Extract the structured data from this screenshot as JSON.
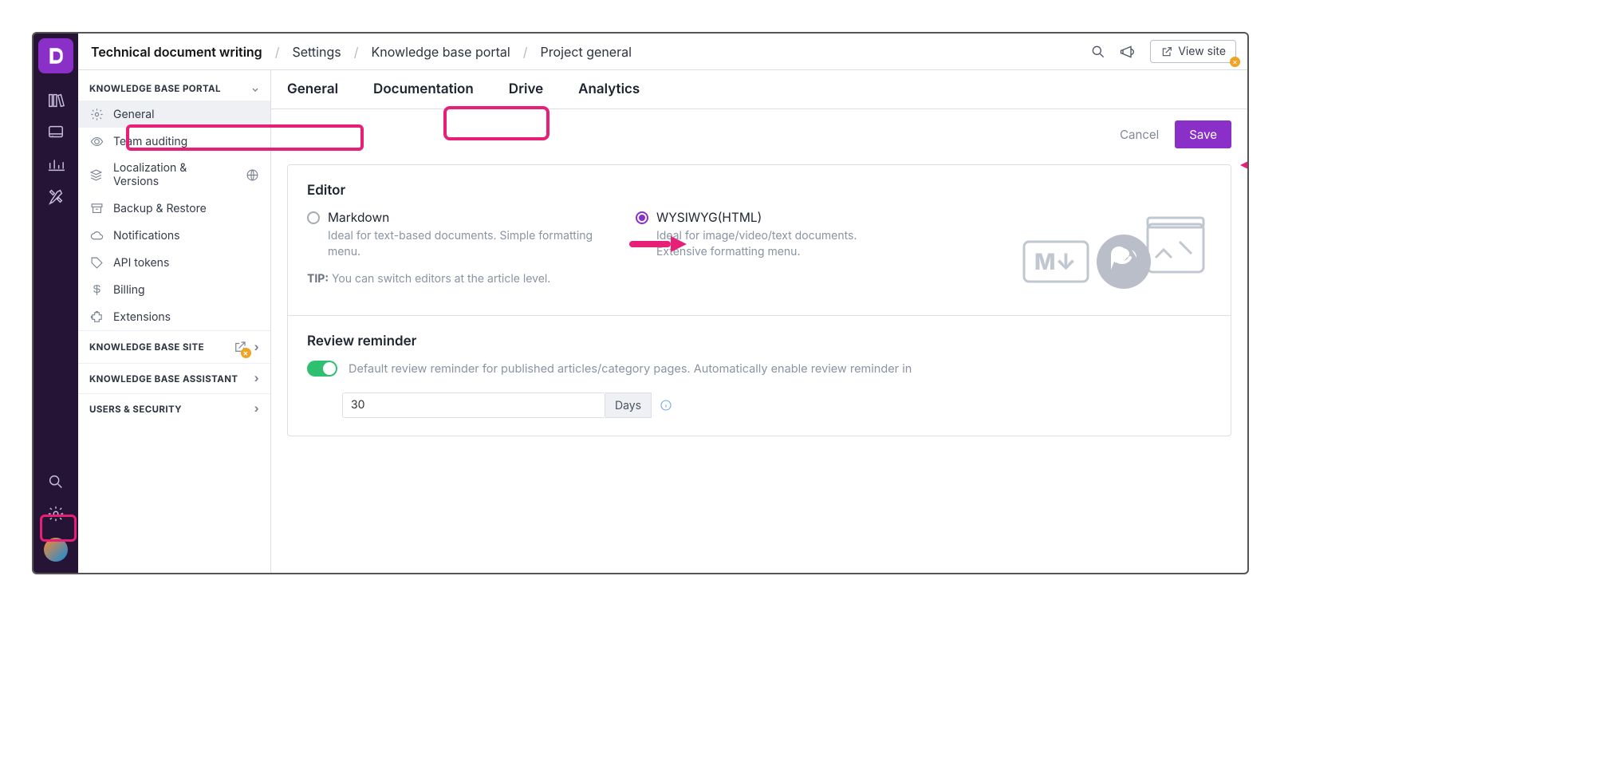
{
  "breadcrumbs": {
    "project": "Technical document writing",
    "settings": "Settings",
    "kb": "Knowledge base portal",
    "page": "Project general"
  },
  "topbar": {
    "view_site": "View site"
  },
  "sidepanel": {
    "sect_portal": "KNOWLEDGE BASE PORTAL",
    "general": "General",
    "team_auditing": "Team auditing",
    "localization": "Localization & Versions",
    "backup": "Backup & Restore",
    "notifications": "Notifications",
    "api_tokens": "API tokens",
    "billing": "Billing",
    "extensions": "Extensions",
    "sect_site": "KNOWLEDGE BASE SITE",
    "sect_assistant": "KNOWLEDGE BASE ASSISTANT",
    "sect_users": "USERS & SECURITY"
  },
  "tabs": {
    "general": "General",
    "documentation": "Documentation",
    "drive": "Drive",
    "analytics": "Analytics"
  },
  "actions": {
    "cancel": "Cancel",
    "save": "Save"
  },
  "editor": {
    "heading": "Editor",
    "markdown": {
      "title": "Markdown",
      "desc": "Ideal for text-based documents. Simple formatting menu."
    },
    "wysiwyg": {
      "title": "WYSIWYG(HTML)",
      "desc": "Ideal for image/video/text documents. Extensive formatting menu."
    },
    "tip_label": "TIP:",
    "tip_text": "You can switch editors at the article level."
  },
  "review": {
    "heading": "Review reminder",
    "desc": "Default review reminder for published articles/category pages. Automatically enable review reminder in",
    "value": "30",
    "unit": "Days"
  }
}
